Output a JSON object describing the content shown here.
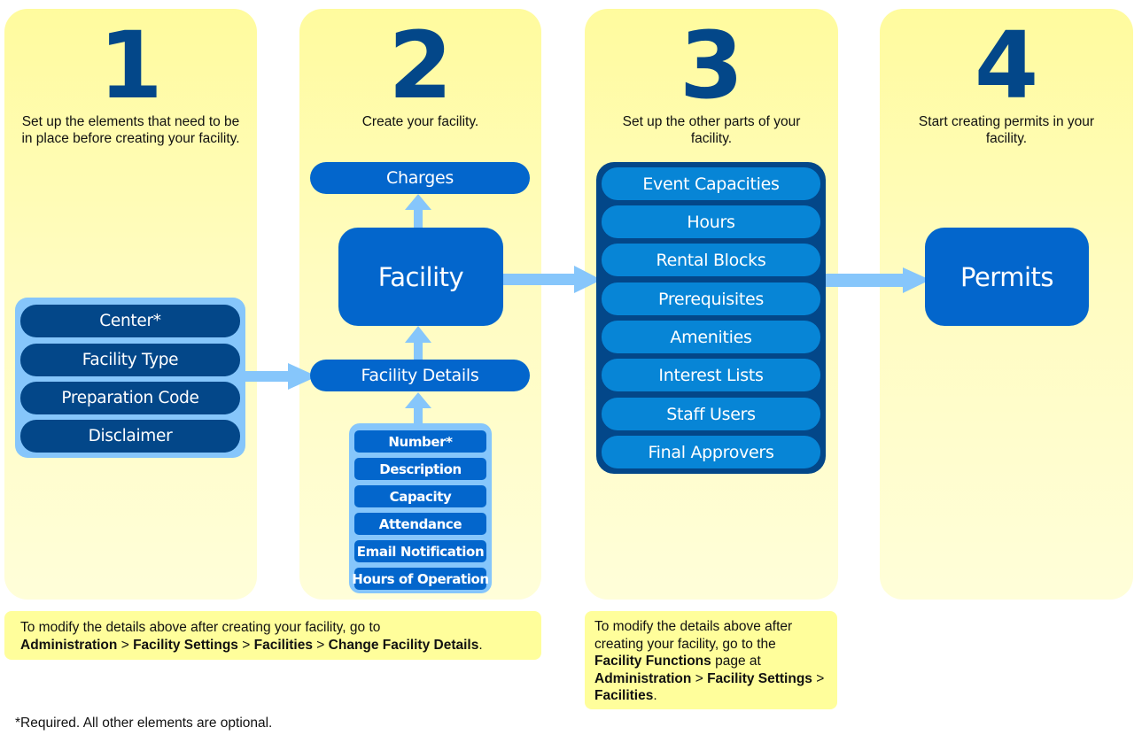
{
  "steps": [
    {
      "number": "1",
      "description": "Set up the elements that need to be in place before creating your facility.",
      "items": [
        "Center*",
        "Facility Type",
        "Preparation Code",
        "Disclaimer"
      ]
    },
    {
      "number": "2",
      "description": "Create your facility.",
      "charges": "Charges",
      "facility": "Facility",
      "facility_details": "Facility Details",
      "details_items": [
        "Number*",
        "Description",
        "Capacity",
        "Attendance",
        "Email Notification",
        "Hours of Operation"
      ]
    },
    {
      "number": "3",
      "description": "Set up the other parts of your facility.",
      "items": [
        "Event Capacities",
        "Hours",
        "Rental Blocks",
        "Prerequisites",
        "Amenities",
        "Interest Lists",
        "Staff Users",
        "Final Approvers"
      ]
    },
    {
      "number": "4",
      "description": "Start creating permits in your facility.",
      "permits": "Permits"
    }
  ],
  "notes": {
    "note1": {
      "intro": "To modify the details above after creating your facility, go to",
      "path": [
        "Administration",
        "Facility Settings",
        "Facilities",
        "Change Facility Details"
      ],
      "separator": ">",
      "end": "."
    },
    "note2": {
      "intro": "To modify the details above after creating your facility, go to the",
      "page": "Facility Functions",
      "mid": "page at",
      "path": [
        "Administration",
        "Facility Settings",
        "Facilities"
      ],
      "separator": ">",
      "end": "."
    }
  },
  "footer": "*Required. All other elements are optional.",
  "colors": {
    "dark_blue": "#034789",
    "mid_blue": "#0366cc",
    "item_blue": "#0785d6",
    "arrow_blue": "#86c6fb",
    "column_yellow": "#fffcc0",
    "note_yellow": "#fffe9b"
  }
}
